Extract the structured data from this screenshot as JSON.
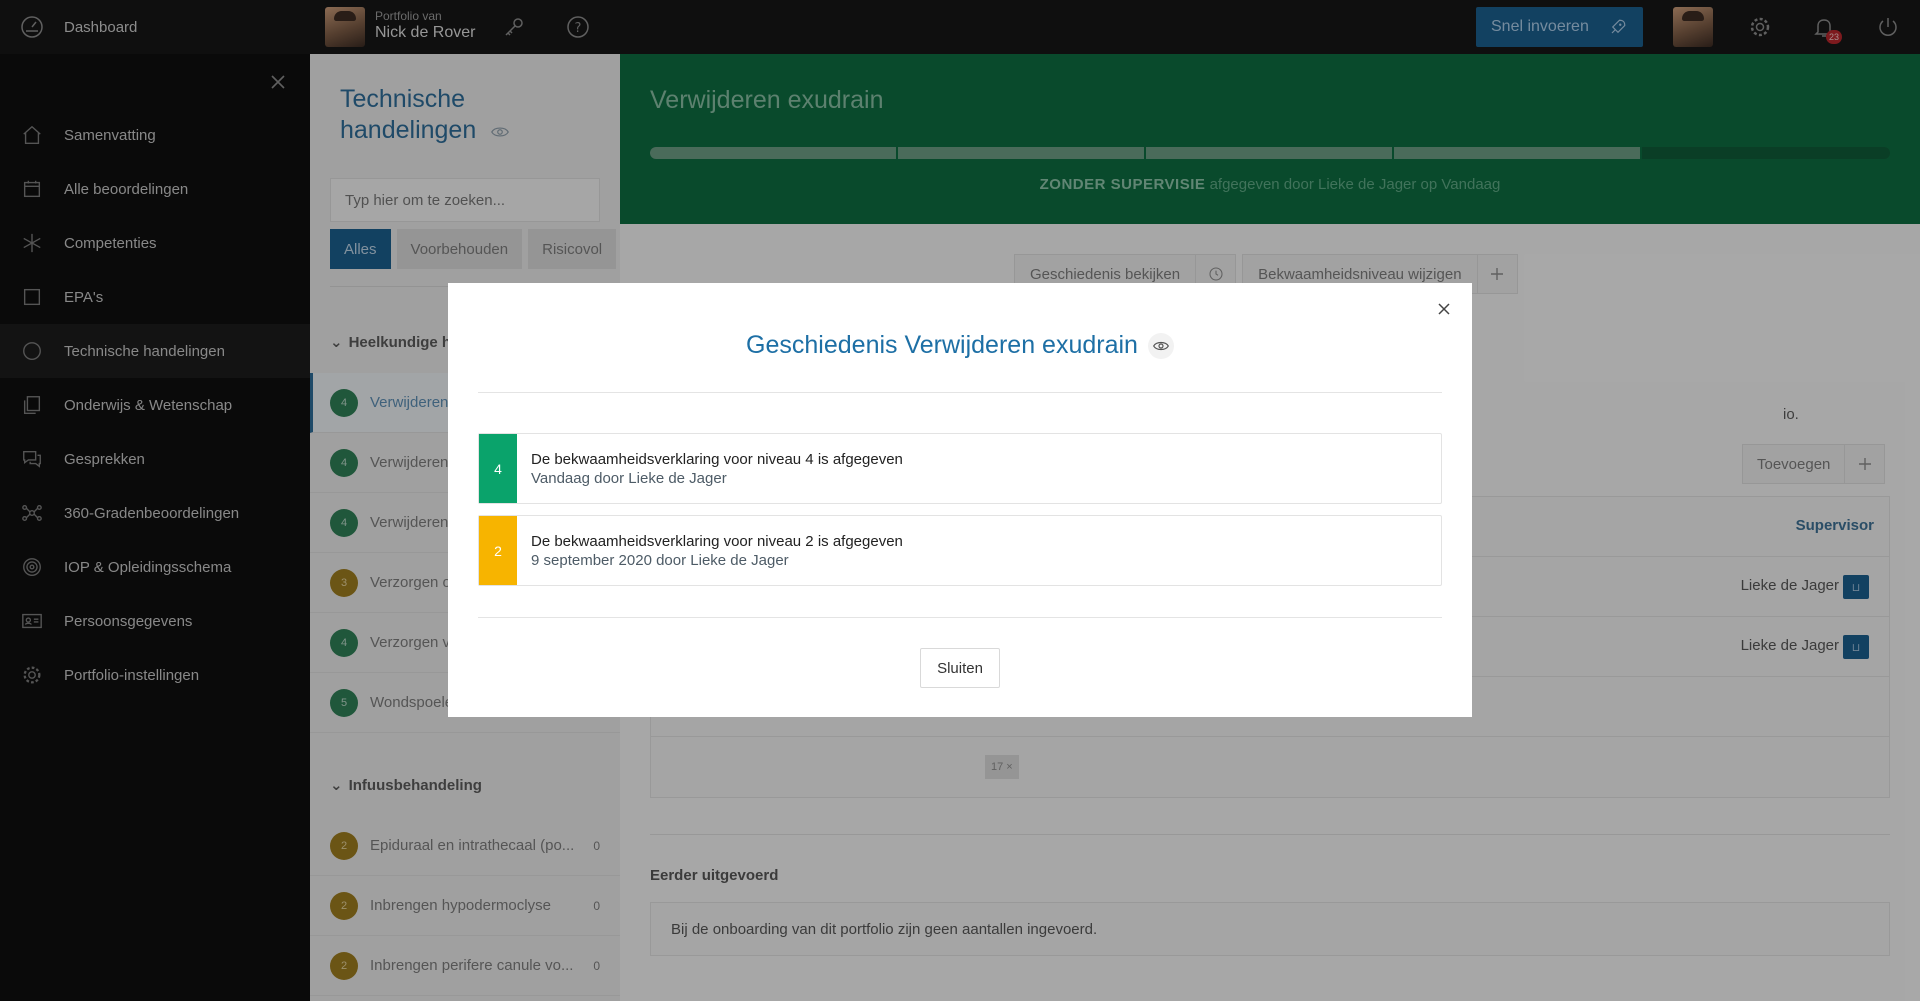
{
  "topbar": {
    "dashboard": "Dashboard",
    "portfolio_small": "Portfolio van",
    "portfolio_name": "Nick de Rover",
    "snel_invoeren": "Snel invoeren",
    "notification_count": "23"
  },
  "sidebar": {
    "items": [
      {
        "label": "Samenvatting",
        "icon": "home-icon"
      },
      {
        "label": "Alle beoordelingen",
        "icon": "calendar-icon"
      },
      {
        "label": "Competenties",
        "icon": "asterisk-icon"
      },
      {
        "label": "EPA's",
        "icon": "square-icon"
      },
      {
        "label": "Technische handelingen",
        "icon": "circle-icon"
      },
      {
        "label": "Onderwijs & Wetenschap",
        "icon": "documents-icon"
      },
      {
        "label": "Gesprekken",
        "icon": "chat-icon"
      },
      {
        "label": "360-Gradenbeoordelingen",
        "icon": "network-icon"
      },
      {
        "label": "IOP & Opleidingsschema",
        "icon": "target-icon"
      },
      {
        "label": "Persoonsgegevens",
        "icon": "id-card-icon"
      },
      {
        "label": "Portfolio-instellingen",
        "icon": "gear-icon"
      }
    ]
  },
  "panel": {
    "title": "Technische handelingen",
    "search_placeholder": "Typ hier om te zoeken...",
    "filters": [
      "Alles",
      "Voorbehouden",
      "Risicovol"
    ],
    "group1": "Heelkundige ha",
    "items1": [
      {
        "level": "4",
        "label": "Verwijderen",
        "color": "green"
      },
      {
        "level": "4",
        "label": "Verwijderen",
        "color": "green"
      },
      {
        "level": "4",
        "label": "Verwijderen",
        "color": "green"
      },
      {
        "level": "3",
        "label": "Verzorgen o",
        "color": "yellow"
      },
      {
        "level": "4",
        "label": "Verzorgen v",
        "color": "green"
      },
      {
        "level": "5",
        "label": "Wondspoele",
        "color": "green"
      }
    ],
    "group2": "Infuusbehandeling",
    "items2": [
      {
        "level": "2",
        "label": "Epiduraal en intrathecaal (po...",
        "count": "0"
      },
      {
        "level": "2",
        "label": "Inbrengen hypodermoclyse",
        "count": "0"
      },
      {
        "level": "2",
        "label": "Inbrengen perifere canule vo...",
        "count": "0"
      }
    ]
  },
  "main": {
    "title": "Verwijderen exudrain",
    "progress_segments": 5,
    "progress_filled": 4,
    "status_bold": "ZONDER SUPERVISIE",
    "status_rest": "afgegeven door Lieke de Jager op Vandaag",
    "btn_history": "Geschiedenis bekijken",
    "btn_level": "Bekwaamheidsniveau wijzigen",
    "partial_text": "io.",
    "btn_add": "Toevoegen",
    "supervisor_header": "Supervisor",
    "supervisor1": "Lieke de Jager",
    "supervisor2": "Lieke de Jager",
    "chip": "17 ×",
    "eerder_title": "Eerder uitgevoerd",
    "eerder_text": "Bij de onboarding van dit portfolio zijn geen aantallen ingevoerd."
  },
  "modal": {
    "title": "Geschiedenis Verwijderen exudrain",
    "entries": [
      {
        "level": "4",
        "line1": "De bekwaamheidsverklaring voor niveau 4 is afgegeven",
        "line2": "Vandaag door Lieke de Jager",
        "color": "#0aa36b"
      },
      {
        "level": "2",
        "line1": "De bekwaamheidsverklaring voor niveau 2 is afgegeven",
        "line2": "9 september 2020 door Lieke de Jager",
        "color": "#f7b400"
      }
    ],
    "close_label": "Sluiten"
  }
}
